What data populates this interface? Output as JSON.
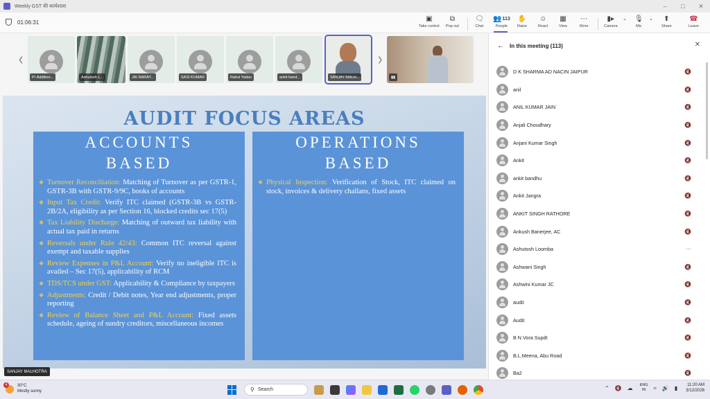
{
  "window": {
    "title": "Weekly GST की कार्यशाला"
  },
  "toolbar": {
    "timer": "01:06:31",
    "buttons": [
      {
        "label": "Take control",
        "icon": "monitor-icon"
      },
      {
        "label": "Pop out",
        "icon": "popout-icon"
      },
      {
        "label": "Chat",
        "icon": "chat-icon"
      },
      {
        "label": "People",
        "icon": "people-icon",
        "count": "113"
      },
      {
        "label": "Raise",
        "icon": "hand-icon"
      },
      {
        "label": "React",
        "icon": "smile-icon"
      },
      {
        "label": "View",
        "icon": "grid-icon"
      },
      {
        "label": "More",
        "icon": "more-icon"
      },
      {
        "label": "Camera",
        "icon": "camera-icon"
      },
      {
        "label": "Mic",
        "icon": "mic-off-icon"
      },
      {
        "label": "Share",
        "icon": "share-icon"
      },
      {
        "label": "Leave",
        "icon": "phone-hangup-icon"
      }
    ]
  },
  "video_strip": {
    "tiles": [
      {
        "name": "Pr Addition..."
      },
      {
        "name": "Ashutosh L..."
      },
      {
        "name": "JAI NARAY..."
      },
      {
        "name": "SASI KUMAR"
      },
      {
        "name": "Rahul Yadav"
      },
      {
        "name": "ankit band..."
      },
      {
        "name": "SANJAY MALH..."
      }
    ]
  },
  "slide": {
    "title": "AUDIT FOCUS AREAS",
    "left_panel": {
      "heading_line1": "ACCOUNTS",
      "heading_line2": "BASED",
      "items": [
        {
          "head": "Turnover Reconciliation:",
          "text": " Matching of Turnover as per GSTR-1, GSTR-3B with GSTR-9/9C, books of accounts"
        },
        {
          "head": "Input Tax Credit:",
          "text": " Verify ITC claimed (GSTR-3B vs GSTR-2B/2A, eligibility as per Section 16, blocked credits sec 17(5)"
        },
        {
          "head": "Tax Liability Discharge:",
          "text": " Matching of outward tax liability with actual tax paid in returns"
        },
        {
          "head": "Reversals under Rule 42/43:",
          "text": " Common ITC reversal against exempt and taxable supplies"
        },
        {
          "head": "Review Expenses in P&L Account:",
          "text": " Verify no ineligible ITC is availed – Sec 17(5), applicability of RCM"
        },
        {
          "head": "TDS/TCS under GST:",
          "text": " Applicability & Compliance by taxpayers"
        },
        {
          "head": "Adjustments:",
          "text": " Credit / Debit notes, Year end adjustments, proper reporting"
        },
        {
          "head": "Review of Balance Sheet and P&L Account:",
          "text": " Fixed assets schedule, ageing of sundry creditors, miscellaneous incomes"
        }
      ]
    },
    "right_panel": {
      "heading_line1": "OPERATIONS",
      "heading_line2": "BASED",
      "items": [
        {
          "head": "Physical Inspection:",
          "text": " Verification of Stock, ITC claimed on stock, invoices & delivery challans, fixed assets"
        }
      ]
    },
    "presenter": "SANJAY MALHOTRA"
  },
  "side_panel": {
    "title": "In this meeting (113)",
    "participants": [
      "D K SHARMA AD NACIN JAIPUR",
      "anil",
      "ANIL KUMAR JAIN",
      "Anjali Choudhary",
      "Anjani Kumar Singh",
      "Ankit",
      "ankit bandhu",
      "Ankit Jangra",
      "ANKIT SINGH RATHORE",
      "Ankush Banerjee, AC",
      "Ashutosh Loomba",
      "Ashwani Singh",
      "Ashwini Kumar JC",
      "audit",
      "Audit",
      "B N Vora Supdt",
      "B.L.Meena, Abu Road",
      "Ba2"
    ]
  },
  "taskbar": {
    "weather_badge": "4",
    "temperature": "30°C",
    "condition": "Mostly sunny",
    "search_placeholder": "Search",
    "lang_line1": "ENG",
    "lang_line2": "IN",
    "time": "11:20 AM",
    "date": "3/12/2026"
  }
}
